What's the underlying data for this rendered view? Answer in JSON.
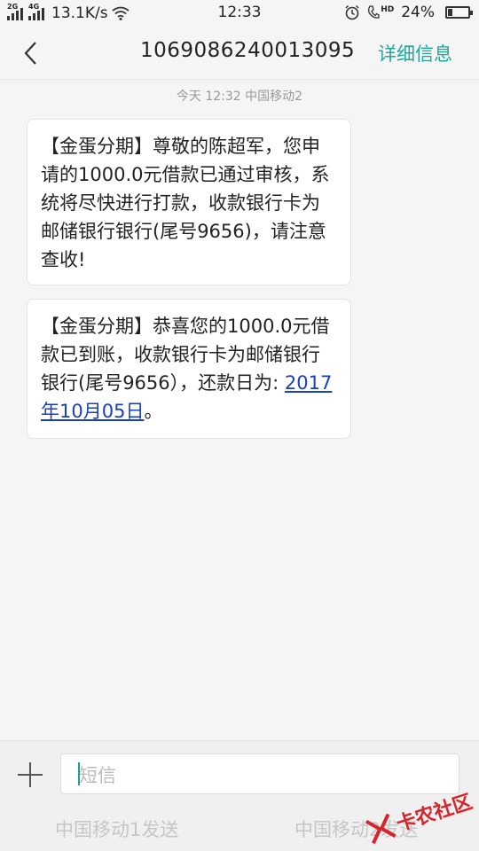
{
  "status_bar": {
    "net_speed": "13.1K/s",
    "time": "12:33",
    "battery": "24%",
    "battery_level": 0.24,
    "sim1_tag": "2G",
    "sim2_tag": "4G",
    "hd_tag": "HD"
  },
  "header": {
    "contact": "1069086240013095",
    "detail_label": "详细信息",
    "accent_color": "#20a89a"
  },
  "messages": {
    "meta": "今天  12:32   中国移动2",
    "m1_text": "【金蛋分期】尊敬的陈超军，您申请的1000.0元借款已通过审核，系统将尽快进行打款，收款银行卡为邮储银行银行(尾号9656)，请注意查收!",
    "m2_text": "【金蛋分期】恭喜您的1000.0元借款已到账，收款银行卡为邮储银行银行(尾号9656），还款日为: ",
    "m2_date": "2017年10月05日",
    "m2_tail": "。"
  },
  "compose": {
    "placeholder": "短信",
    "send1": "中国移动1发送",
    "send2": "中国移动2发送"
  },
  "watermark": {
    "text": "卡农社区",
    "color": "#d8232a"
  }
}
